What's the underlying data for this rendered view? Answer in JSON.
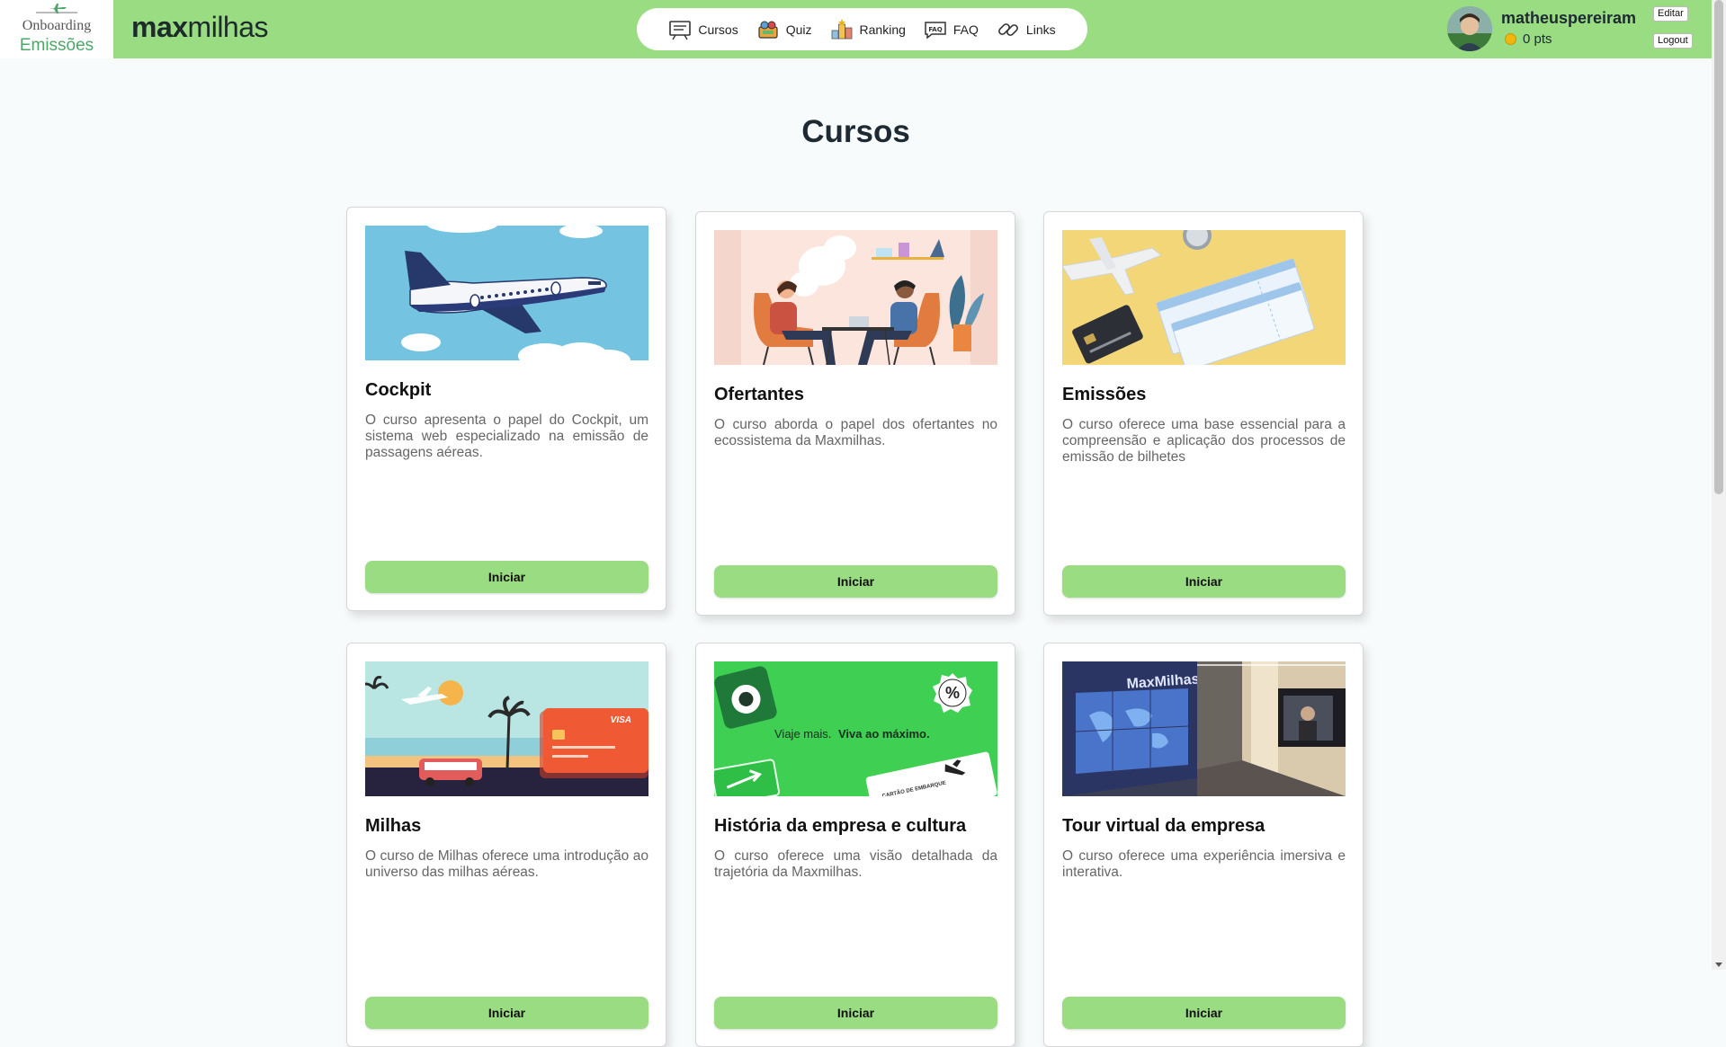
{
  "header": {
    "logo_line1": "Onboarding",
    "logo_line2": "Emissões",
    "brand_bold": "max",
    "brand_rest": "milhas",
    "nav": [
      {
        "label": "Cursos",
        "icon": "courses-icon"
      },
      {
        "label": "Quiz",
        "icon": "quiz-icon"
      },
      {
        "label": "Ranking",
        "icon": "ranking-icon"
      },
      {
        "label": "FAQ",
        "icon": "faq-icon"
      },
      {
        "label": "Links",
        "icon": "link-icon"
      }
    ],
    "user": {
      "name": "matheuspereiram",
      "points": "0 pts"
    },
    "edit_label": "Editar",
    "logout_label": "Logout"
  },
  "main": {
    "title": "Cursos",
    "button_label": "Iniciar",
    "courses": [
      {
        "title": "Cockpit",
        "description": "O curso apresenta o papel do Cockpit, um sistema web especializado na emissão de passagens aéreas.",
        "image": "airplane-sky-illustration"
      },
      {
        "title": "Ofertantes",
        "description": "O curso aborda o papel dos ofertantes no ecossistema da Maxmilhas.",
        "image": "two-people-talking-illustration"
      },
      {
        "title": "Emissões",
        "description": "O curso oferece uma base essencial para a compreensão e aplicação dos processos de emissão de bilhetes",
        "image": "tickets-and-card-photo"
      },
      {
        "title": "Milhas",
        "description": "O curso de Milhas oferece uma introdução ao universo das milhas aéreas.",
        "image": "beach-credit-card-illustration"
      },
      {
        "title": "História da empresa e cultura",
        "description": "O curso oferece uma visão detalhada da trajetória da Maxmilhas.",
        "image": "brand-banner",
        "banner_text_regular": "Viaje mais.",
        "banner_text_bold": "Viva ao máximo.",
        "banner_ticket_text": "CARTÃO DE EMBARQUE"
      },
      {
        "title": "Tour virtual da empresa",
        "description": "O curso oferece uma experiência imersiva e interativa.",
        "image": "office-photo",
        "sign_text": "MaxMilhas"
      }
    ]
  },
  "colors": {
    "accent": "#99dc82",
    "logo_green": "#4fa56a",
    "background": "#f8fbfc"
  }
}
